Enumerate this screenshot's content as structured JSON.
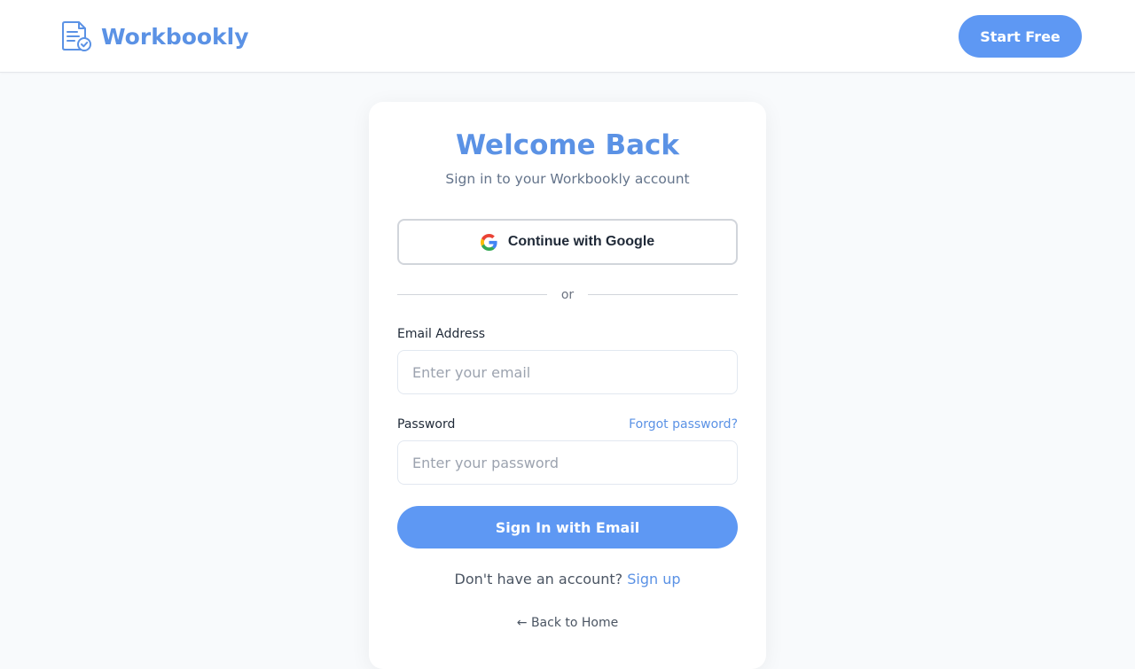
{
  "header": {
    "brand": "Workbookly",
    "logo_icon": "document-check-icon",
    "cta_label": "Start Free"
  },
  "card": {
    "title": "Welcome Back",
    "subtitle": "Sign in to your Workbookly account",
    "google_button": {
      "label": "Continue with Google",
      "icon": "google-icon"
    },
    "divider_text": "or",
    "email": {
      "label": "Email Address",
      "placeholder": "Enter your email",
      "value": ""
    },
    "password": {
      "label": "Password",
      "placeholder": "Enter your password",
      "value": "",
      "forgot_label": "Forgot password?"
    },
    "submit_label": "Sign In with Email",
    "signup_prompt": "Don't have an account?",
    "signup_link": "Sign up",
    "back_link": "← Back to Home"
  },
  "colors": {
    "accent": "#5b92e5",
    "button": "#5e98f3",
    "background": "#f8fafc",
    "card": "#ffffff"
  }
}
